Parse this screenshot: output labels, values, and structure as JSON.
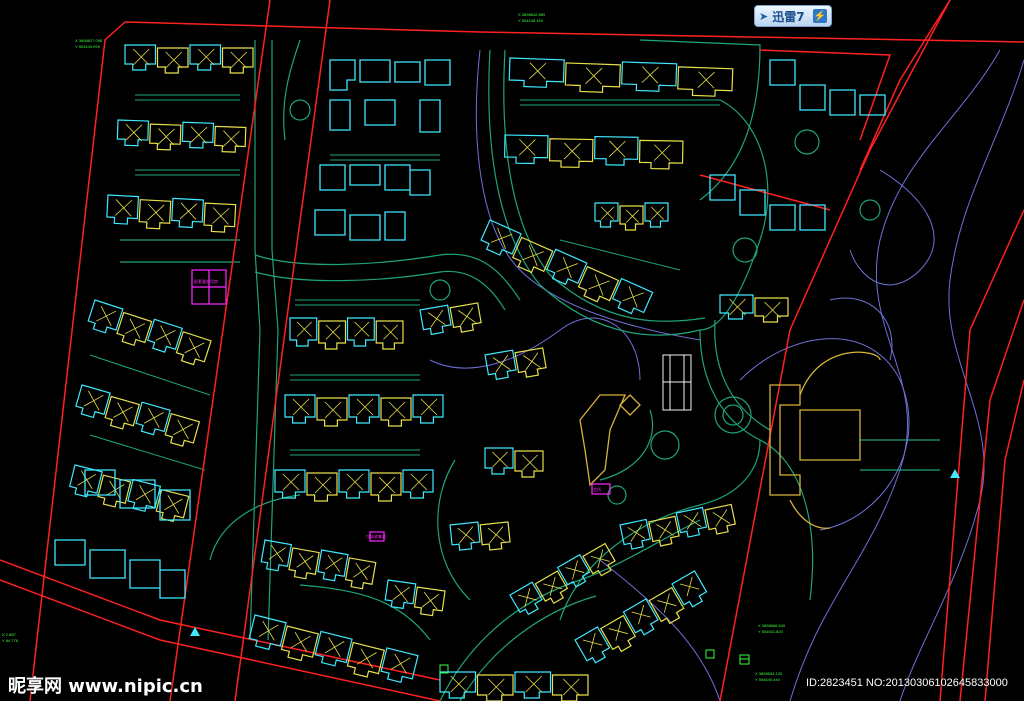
{
  "app_badge": {
    "label": "迅雷7",
    "icon": "bird-logo-icon",
    "action_icon": "lightning-icon"
  },
  "watermark": {
    "site": "昵享网 www.nipic.cn",
    "id_text": "ID:2823451 NO:20130306102645833000"
  },
  "drawing_labels": {
    "top_coord": [
      "X 3898842.869",
      "Y 504448.149"
    ],
    "left_coord": [
      "X 3898827.098",
      "Y 503449.099"
    ],
    "bottom_left_coord": [
      "X 2.887",
      "Y 84.776"
    ],
    "bottom_right_coord_a": [
      "X 3898666.849",
      "Y 504631.820"
    ],
    "bottom_right_coord_b": [
      "X 3898654.120",
      "Y 504640.440"
    ],
    "pink_block_1": "配套服务用房",
    "pink_block_2": "会所",
    "pink_block_3": "垃圾收集站"
  },
  "colors": {
    "background": "#000000",
    "boundary_red": "#ff2020",
    "road_green": "#1fa37a",
    "building_cyan": "#3fe9ff",
    "building_yellow": "#e8e04a",
    "clubhouse_gold": "#d8b43a",
    "contour_blue": "#6f70d8",
    "label_green": "#39ff39",
    "annotation_magenta": "#ff28ff",
    "court_white": "#f2f2f2"
  }
}
